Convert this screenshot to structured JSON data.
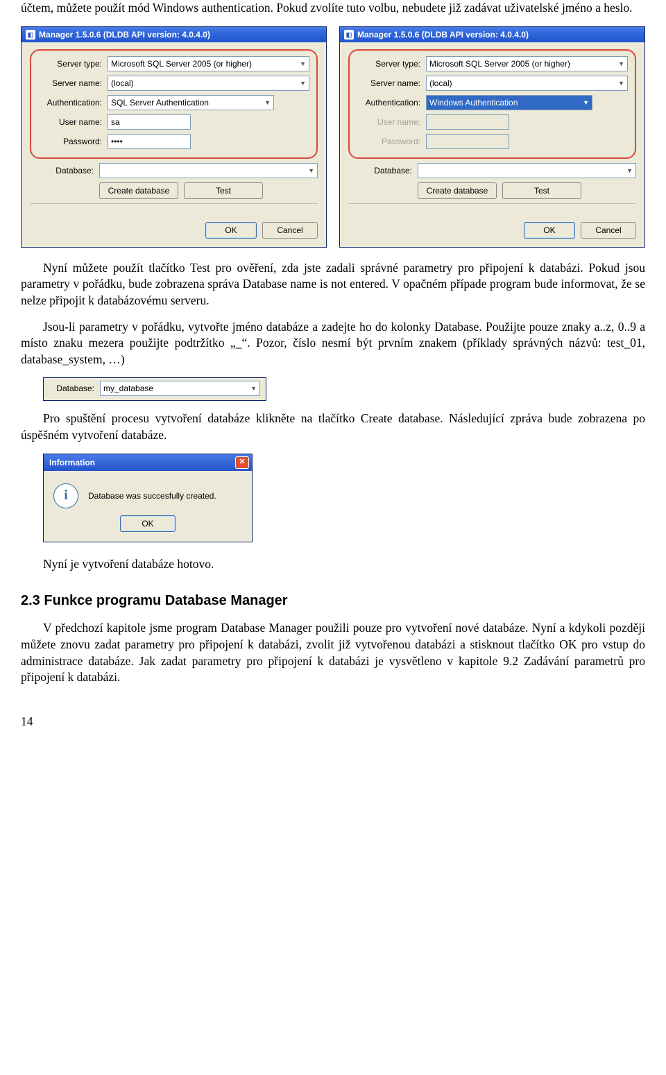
{
  "body": {
    "p1": "účtem, můžete  použít mód Windows authentication. Pokud zvolíte tuto volbu, nebudete již zadávat uživatelské jméno a heslo.",
    "p2": "Nyní můžete použít tlačítko Test pro ověření, zda jste zadali správné parametry pro připojení k databázi. Pokud jsou parametry v pořádku, bude zobrazena správa Database name is not entered. V opačném případe program bude informovat, že se nelze připojit k databázovému serveru.",
    "p3a": "Jsou-li parametry v pořádku, vytvořte jméno databáze a zadejte ho do kolonky Database. Použijte pouze znaky a..z, 0..9 a místo znaku mezera použijte podtržítko „_“. Pozor, číslo nesmí být prvním znakem (příklady správných názvů: test_01, database_system, …)",
    "p4": "Pro spuštění procesu vytvoření databáze klikněte na tlačítko Create database. Následující zpráva bude zobrazena po úspěšném vytvoření databáze.",
    "p5": "Nyní je vytvoření databáze hotovo.",
    "p6": "V předchozí kapitole jsme program Database Manager použili pouze pro vytvoření nové databáze. Nyní a kdykoli později můžete znovu zadat parametry pro připojení k databázi, zvolit již vytvořenou databázi a stisknout tlačítko OK pro vstup do administrace databáze. Jak zadat parametry pro připojení k databázi je vysvětleno v kapitole 9.2 Zadávání parametrů pro připojení k databázi."
  },
  "section": {
    "title": "2.3 Funkce programu Database Manager"
  },
  "page": "14",
  "dlg": {
    "title": "Manager 1.5.0.6 (DLDB API version: 4.0.4.0)",
    "labels": {
      "server_type": "Server type:",
      "server_name": "Server name:",
      "auth": "Authentication:",
      "user": "User name:",
      "pass": "Password:",
      "db": "Database:"
    },
    "vals": {
      "server_type": "Microsoft SQL Server 2005 (or higher)",
      "server_name": "(local)",
      "auth_sql": "SQL Server Authentication",
      "auth_win": "Windows Authentication",
      "user": "sa",
      "pass": "••••",
      "mydb": "my_database"
    },
    "btn": {
      "create": "Create database",
      "test": "Test",
      "ok": "OK",
      "cancel": "Cancel"
    }
  },
  "info": {
    "title": "Information",
    "msg": "Database was succesfully created.",
    "ok": "OK"
  }
}
